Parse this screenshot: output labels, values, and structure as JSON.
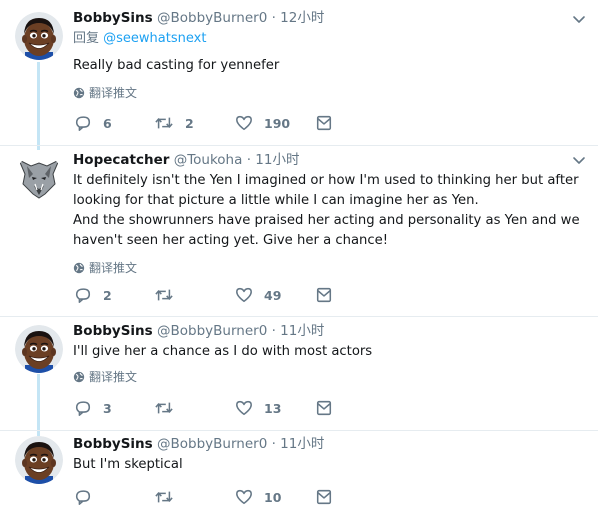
{
  "tweets": [
    {
      "name": "BobbySins",
      "handle": "@BobbyBurner0",
      "time": "12小时",
      "reply_prefix": "回复",
      "reply_to": "@seewhatsnext",
      "text": [
        "Really bad casting for yennefer"
      ],
      "translate": "翻译推文",
      "replies": "6",
      "retweets": "2",
      "likes": "190",
      "avatar": "cartoon-face-avatar"
    },
    {
      "name": "Hopecatcher",
      "handle": "@Toukoha",
      "time": "11小时",
      "text": [
        "It definitely isn't the Yen I imagined or how I'm used to thinking her but after",
        "looking for that picture a little while I can imagine her as Yen.",
        "And the showrunners have praised her acting and personality as Yen and we",
        "haven't seen her acting yet. Give her a chance!"
      ],
      "translate": "翻译推文",
      "replies": "2",
      "retweets": "",
      "likes": "49",
      "avatar": "wolf-medallion-avatar"
    },
    {
      "name": "BobbySins",
      "handle": "@BobbyBurner0",
      "time": "11小时",
      "text": [
        "I'll give her a chance as I do with most actors"
      ],
      "translate": "翻译推文",
      "replies": "3",
      "retweets": "",
      "likes": "13",
      "avatar": "cartoon-face-avatar"
    },
    {
      "name": "BobbySins",
      "handle": "@BobbyBurner0",
      "time": "11小时",
      "text": [
        "But I'm skeptical"
      ],
      "replies": "",
      "retweets": "",
      "likes": "10",
      "avatar": "cartoon-face-avatar"
    }
  ],
  "colors": {
    "text": "#14171a",
    "muted": "#657786",
    "link": "#1da1f2",
    "thread_line": "#c4e5f5",
    "divider": "#e6ecf0"
  }
}
